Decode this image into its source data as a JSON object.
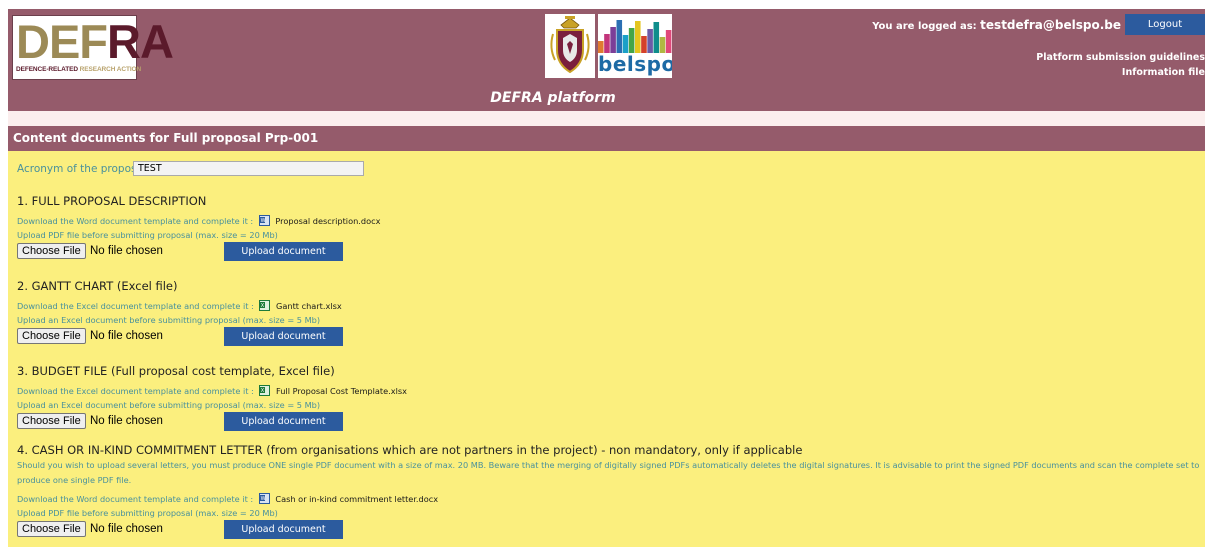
{
  "header": {
    "logo": {
      "line1a": "DEF",
      "line1b": "RA",
      "sub1": "DEFENCE-RELATED",
      "sub2": "RESEARCH ACTION"
    },
    "crest_icon": "royal-military-academy-crest",
    "belspo_text": "belspo",
    "belspo_bar_colors": [
      "#e07a2f",
      "#c2357b",
      "#7b3f98",
      "#2a6fb3",
      "#1aa0c8",
      "#44a548",
      "#e4c51f",
      "#d4412a",
      "#6c5ba7",
      "#0f8d8c",
      "#b0b743",
      "#e0487a"
    ],
    "platform_title": "DEFRA platform",
    "logged_as_label": "You are logged as:",
    "logged_as_email": "testdefra@belspo.be",
    "logout_label": "Logout",
    "guidelines_link": "Platform submission guidelines",
    "info_link": "Information file"
  },
  "section_title": "Content documents for Full proposal Prp-001",
  "acronym": {
    "label": "Acronym of the proposal :",
    "value": "TEST"
  },
  "file_input": {
    "choose_label": "Choose File",
    "no_file_label": "No file chosen"
  },
  "upload_label": "Upload document",
  "sections": [
    {
      "heading": "1. FULL PROPOSAL DESCRIPTION",
      "download_text": "Download the Word document template and complete it :",
      "file_name": "Proposal description.docx",
      "file_icon": "word-document-icon",
      "upload_text": "Upload PDF file before submitting proposal (max. size = 20 Mb)"
    },
    {
      "heading": "2. GANTT CHART (Excel file)",
      "download_text": "Download the Excel document template and complete it :",
      "file_name": "Gantt chart.xlsx",
      "file_icon": "excel-document-icon",
      "upload_text": "Upload an Excel document before submitting proposal (max. size = 5 Mb)"
    },
    {
      "heading": "3. BUDGET FILE (Full proposal cost template, Excel file)",
      "download_text": "Download the Excel document template and complete it :",
      "file_name": "Full Proposal Cost Template.xlsx",
      "file_icon": "excel-document-icon",
      "upload_text": "Upload an Excel document before submitting proposal (max. size = 5 Mb)"
    },
    {
      "heading": "4. CASH OR IN-KIND COMMITMENT LETTER (from organisations which are not partners in the project) - non mandatory, only if applicable",
      "note": "Should you wish to upload several letters, you must produce ONE single PDF document with a size of max. 20 MB. Beware that the merging of digitally signed PDFs automatically deletes the digital signatures. It is advisable to print the signed PDF documents and scan the complete set to produce one single PDF file.",
      "download_text": "Download the Word document template and complete it :",
      "file_name": "Cash or in-kind commitment letter.docx",
      "file_icon": "word-document-icon",
      "upload_text": "Upload PDF file before submitting proposal (max. size = 20 Mb)"
    }
  ],
  "colors": {
    "header_bg": "#955b6b",
    "main_bg": "#fbef7e",
    "button_blue": "#2c5b9e",
    "label_teal": "#49919c"
  }
}
